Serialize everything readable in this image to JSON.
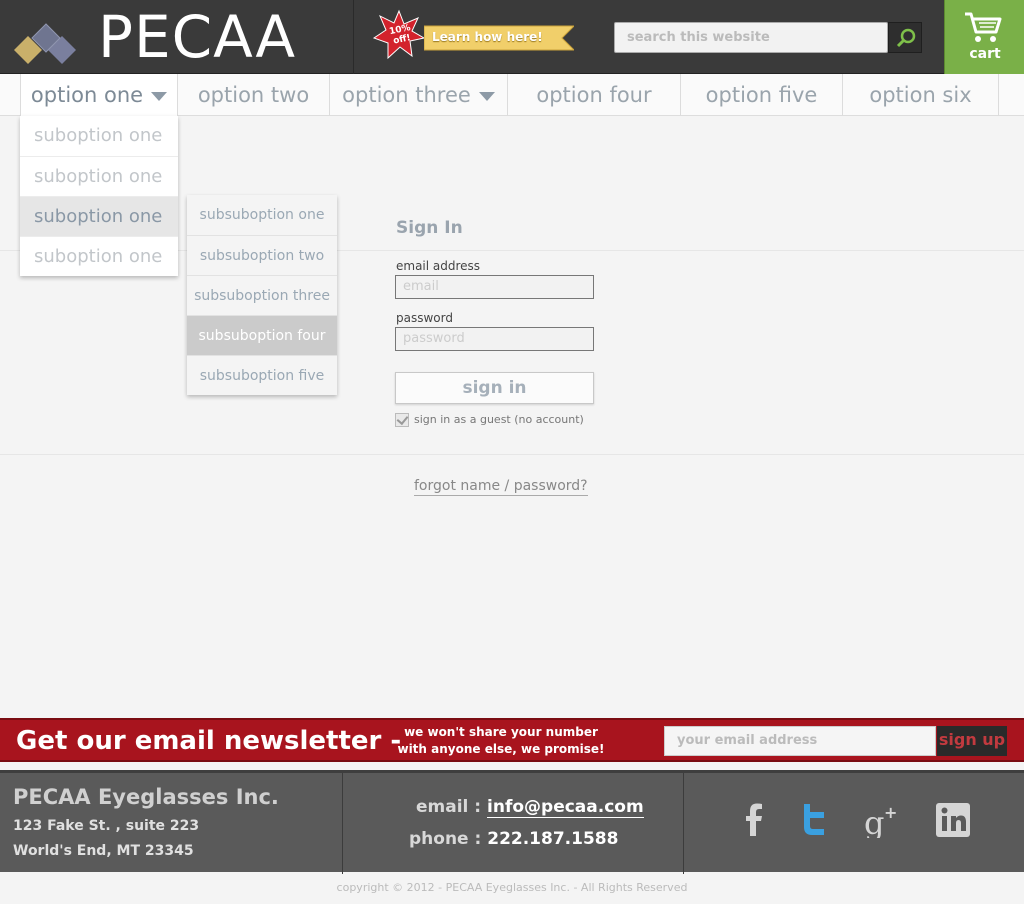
{
  "header": {
    "logo_text": "PECAA",
    "promo": {
      "badge": "10% off!",
      "ribbon": "Learn how here!"
    },
    "search": {
      "placeholder": "search this website"
    },
    "cart": {
      "label": "cart"
    }
  },
  "nav": {
    "items": [
      {
        "label": "option one"
      },
      {
        "label": "option two"
      },
      {
        "label": "option three"
      },
      {
        "label": "option four"
      },
      {
        "label": "option five"
      },
      {
        "label": "option six"
      }
    ],
    "dropdown": [
      {
        "label": "suboption one"
      },
      {
        "label": "suboption one"
      },
      {
        "label": "suboption one"
      },
      {
        "label": "suboption one"
      }
    ],
    "subdropdown": [
      {
        "label": "subsuboption one"
      },
      {
        "label": "subsuboption two"
      },
      {
        "label": "subsuboption three"
      },
      {
        "label": "subsuboption four"
      },
      {
        "label": "subsuboption five"
      }
    ]
  },
  "signin": {
    "title": "Sign In",
    "email_label": "email address",
    "email_placeholder": "email",
    "password_label": "password",
    "password_placeholder": "password",
    "button": "sign in",
    "guest": "sign in as a guest (no account)",
    "forgot": "forgot name / password?"
  },
  "newsletter": {
    "title": "Get our email newsletter -",
    "note": "we won't share your number with anyone else, we promise!",
    "placeholder": "your email address",
    "button": "sign up"
  },
  "footer": {
    "company": "PECAA Eyeglasses Inc.",
    "address_line1": "123 Fake St. , suite 223",
    "address_line2": "World's End, MT 23345",
    "email_label": "email :",
    "email": "info@pecaa.com",
    "phone_label": "phone :",
    "phone": "222.187.1588",
    "copyright": "copyright © 2012 - PECAA Eyeglasses Inc. - All Rights Reserved"
  },
  "colors": {
    "header_bg": "#3a3a3a",
    "cart_green": "#7ab048",
    "newsletter_red": "#a8141e",
    "footer_bg": "#5a5a5a",
    "twitter_blue": "#3aa0e0"
  },
  "icons": [
    "logo-diamonds-icon",
    "star-badge-icon",
    "search-icon",
    "cart-icon",
    "facebook-icon",
    "twitter-icon",
    "google-plus-icon",
    "linkedin-icon",
    "chevron-down-icon",
    "checkbox-check-icon"
  ]
}
